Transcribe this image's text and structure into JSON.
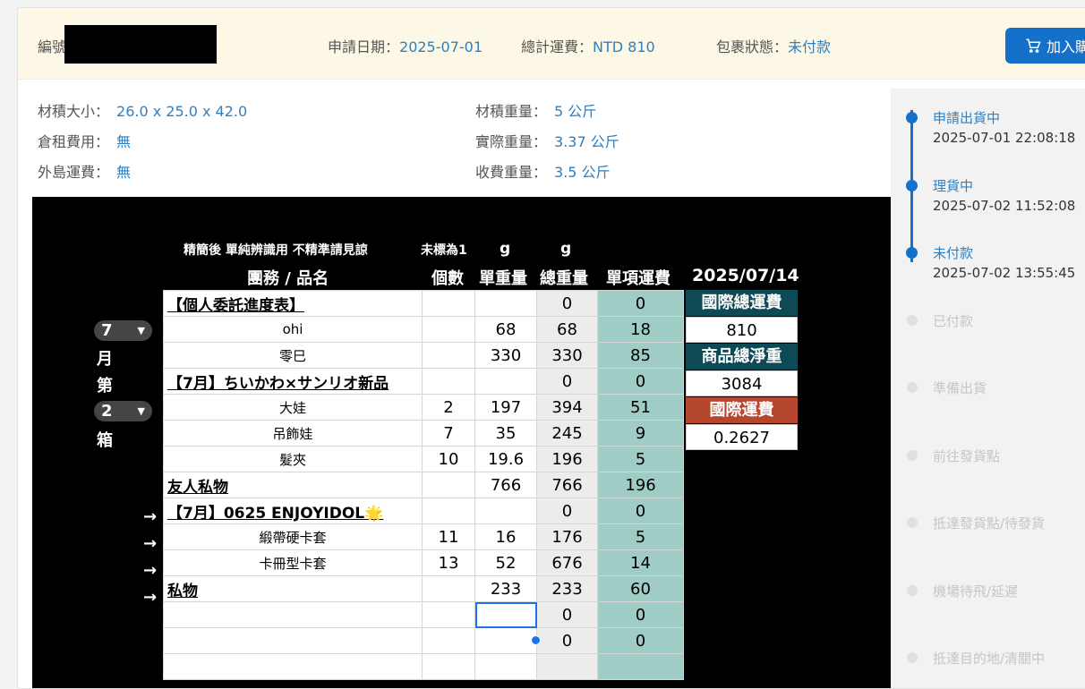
{
  "header": {
    "order_label": "編號",
    "apply_date_label": "申請日期：",
    "apply_date": "2025-07-01",
    "total_fee_label": "總計運費：",
    "total_fee": "NTD 810",
    "package_status_label": "包裹狀態：",
    "package_status": "未付款",
    "cart_button": "加入購"
  },
  "info": {
    "volume_label": "材積大小：",
    "volume": "26.0 x 25.0 x 42.0",
    "volume_weight_label": "材積重量：",
    "volume_weight": "5 公斤",
    "storage_label": "倉租費用：",
    "storage": "無",
    "actual_weight_label": "實際重量：",
    "actual_weight": "3.37 公斤",
    "island_label": "外島運費：",
    "island": "無",
    "charge_weight_label": "收費重量：",
    "charge_weight": "3.5 公斤"
  },
  "sheet": {
    "note_left": "精簡後 單純辨識用 不精準請見諒",
    "note_unmarked": "未標為1",
    "unit_g1": "g",
    "unit_g2": "g",
    "col_name": "團務 / 品名",
    "col_qty": "個數",
    "col_unit_weight": "單重量",
    "col_total_weight": "總重量",
    "col_item_fee": "單項運費",
    "col_date": "2025/07/14",
    "month_value": "7",
    "month_label": "月",
    "di_label": "第",
    "box_value": "2",
    "box_label": "箱",
    "rows": [
      {
        "name": "【個人委託進度表】",
        "qty": "",
        "unit": "",
        "total": "0",
        "fee": "0",
        "header": true,
        "arrow": ""
      },
      {
        "name": "ohi",
        "qty": "",
        "unit": "68",
        "total": "68",
        "fee": "18",
        "header": false,
        "arrow": ""
      },
      {
        "name": "零巳",
        "qty": "",
        "unit": "330",
        "total": "330",
        "fee": "85",
        "header": false,
        "arrow": ""
      },
      {
        "name": "【7月】ちいかわ×サンリオ新品",
        "qty": "",
        "unit": "",
        "total": "0",
        "fee": "0",
        "header": true,
        "arrow": ""
      },
      {
        "name": "大娃",
        "qty": "2",
        "unit": "197",
        "total": "394",
        "fee": "51",
        "header": false,
        "arrow": ""
      },
      {
        "name": "吊飾娃",
        "qty": "7",
        "unit": "35",
        "total": "245",
        "fee": "9",
        "header": false,
        "arrow": ""
      },
      {
        "name": "髮夾",
        "qty": "10",
        "unit": "19.6",
        "total": "196",
        "fee": "5",
        "header": false,
        "arrow": ""
      },
      {
        "name": " 友人私物",
        "qty": "",
        "unit": "766",
        "total": "766",
        "fee": "196",
        "header": true,
        "arrow": ""
      },
      {
        "name": "【7月】0625 ENJOYIDOL🌟",
        "qty": "",
        "unit": "",
        "total": "0",
        "fee": "0",
        "header": true,
        "arrow": "→"
      },
      {
        "name": "緞帶硬卡套",
        "qty": "11",
        "unit": "16",
        "total": "176",
        "fee": "5",
        "header": false,
        "arrow": "→"
      },
      {
        "name": "卡冊型卡套",
        "qty": "13",
        "unit": "52",
        "total": "676",
        "fee": "14",
        "header": false,
        "arrow": "→"
      },
      {
        "name": " 私物",
        "qty": "",
        "unit": "233",
        "total": "233",
        "fee": "60",
        "header": true,
        "arrow": "→"
      },
      {
        "name": "",
        "qty": "",
        "unit": "",
        "total": "0",
        "fee": "0",
        "header": false,
        "arrow": ""
      },
      {
        "name": "",
        "qty": "",
        "unit": "",
        "total": "0",
        "fee": "0",
        "header": false,
        "arrow": ""
      },
      {
        "name": "",
        "qty": "",
        "unit": "",
        "total": "",
        "fee": "",
        "header": false,
        "arrow": ""
      }
    ],
    "side": {
      "intl_total_label": "國際總運費",
      "intl_total": "810",
      "net_weight_label": "商品總淨重",
      "net_weight": "3084",
      "intl_fee_label": "國際運費",
      "intl_fee": "0.2627"
    }
  },
  "timeline": [
    {
      "title": "申請出貨中",
      "time": "2025-07-01 22:08:18",
      "active": true
    },
    {
      "title": "理貨中",
      "time": "2025-07-02 11:52:08",
      "active": true
    },
    {
      "title": "未付款",
      "time": "2025-07-02 13:55:45",
      "active": true
    },
    {
      "title": "已付款",
      "time": "",
      "active": false
    },
    {
      "title": "準備出貨",
      "time": "",
      "active": false
    },
    {
      "title": "前往發貨點",
      "time": "",
      "active": false
    },
    {
      "title": "抵達發貨點/待發貨",
      "time": "",
      "active": false
    },
    {
      "title": "機場待飛/延遲",
      "time": "",
      "active": false
    },
    {
      "title": "抵達目的地/清關中",
      "time": "",
      "active": false
    }
  ]
}
